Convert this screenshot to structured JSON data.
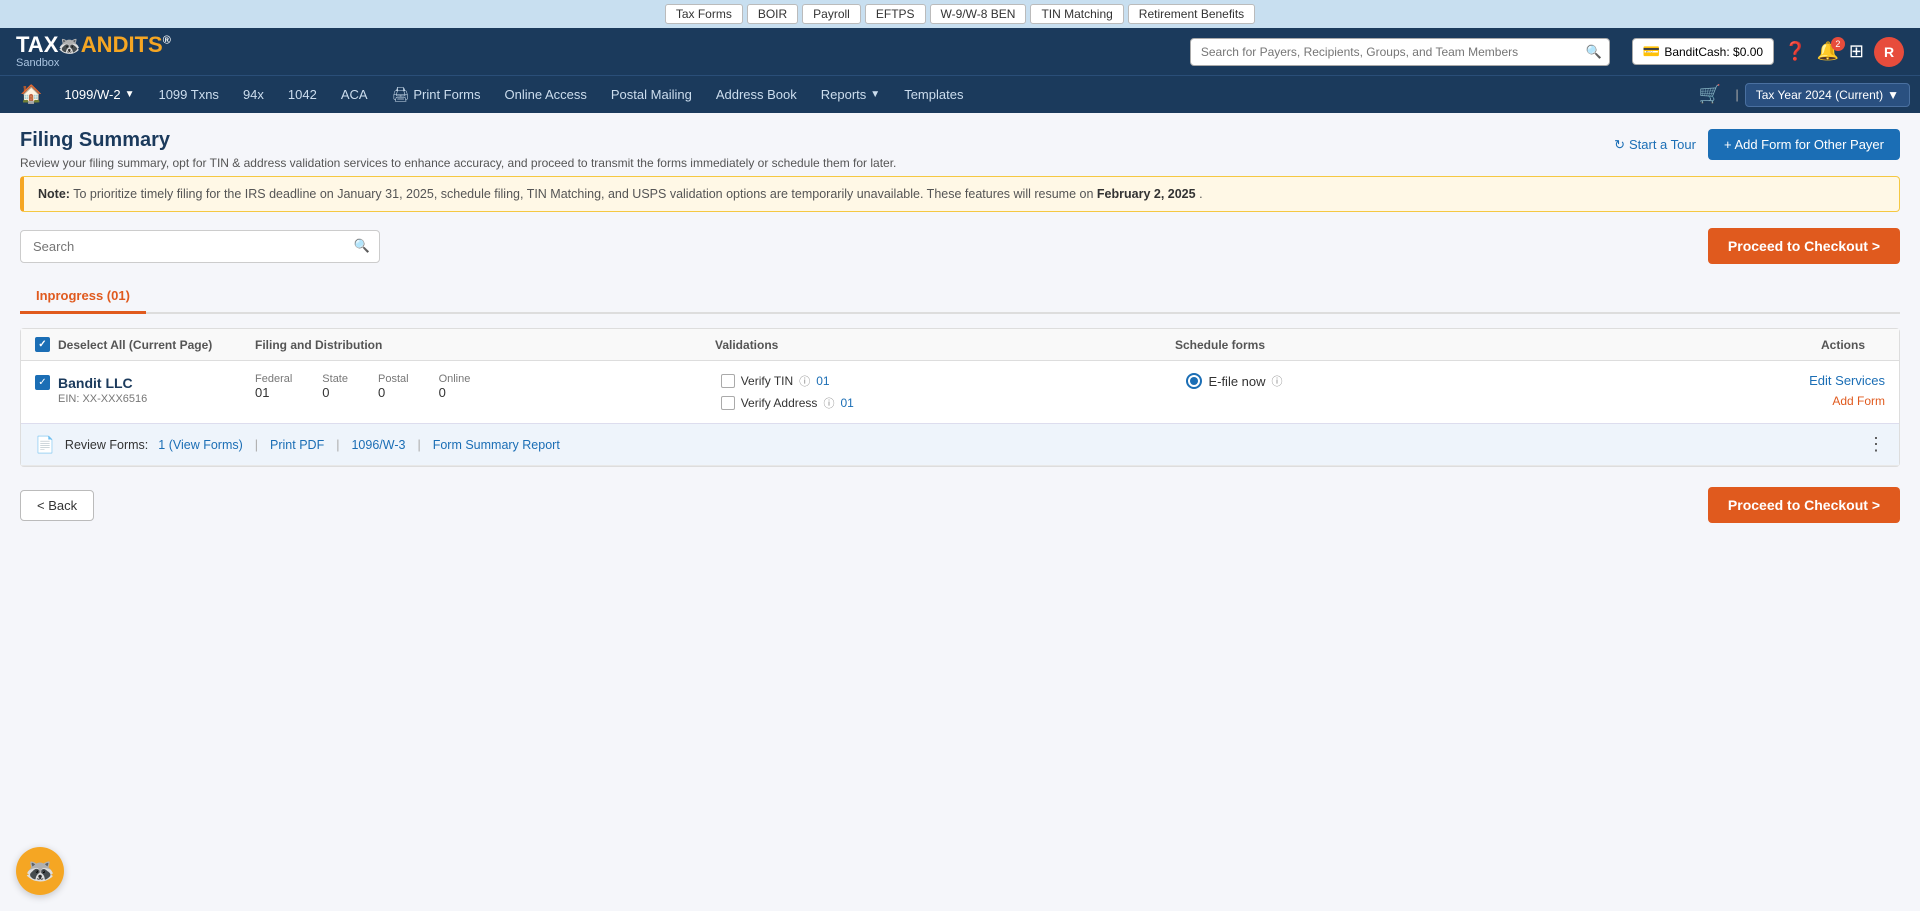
{
  "topnav": {
    "items": [
      {
        "id": "tax-forms",
        "label": "Tax Forms"
      },
      {
        "id": "boir",
        "label": "BOIR"
      },
      {
        "id": "payroll",
        "label": "Payroll"
      },
      {
        "id": "eftps",
        "label": "EFTPS"
      },
      {
        "id": "w9w8ben",
        "label": "W-9/W-8 BEN"
      },
      {
        "id": "tin-matching",
        "label": "TIN Matching"
      },
      {
        "id": "retirement-benefits",
        "label": "Retirement Benefits"
      }
    ]
  },
  "header": {
    "logo_main": "TAX",
    "logo_brand": "BANDITS",
    "logo_reg": "®",
    "sandbox": "Sandbox",
    "search_placeholder": "Search for Payers, Recipients, Groups, and Team Members",
    "bandit_cash_label": "BanditCash: $0.00",
    "notification_count": "2",
    "avatar_initial": "R"
  },
  "mainnav": {
    "items": [
      {
        "id": "1099w2",
        "label": "1099/W-2",
        "has_dropdown": true
      },
      {
        "id": "1099txns",
        "label": "1099 Txns"
      },
      {
        "id": "94x",
        "label": "94x"
      },
      {
        "id": "1042",
        "label": "1042"
      },
      {
        "id": "aca",
        "label": "ACA"
      },
      {
        "id": "print-forms",
        "label": "Print Forms",
        "has_icon": true
      },
      {
        "id": "online-access",
        "label": "Online Access"
      },
      {
        "id": "postal-mailing",
        "label": "Postal Mailing"
      },
      {
        "id": "address-book",
        "label": "Address Book"
      },
      {
        "id": "reports",
        "label": "Reports",
        "has_dropdown": true
      },
      {
        "id": "templates",
        "label": "Templates"
      }
    ],
    "tax_year": "Tax Year 2024 (Current)"
  },
  "page": {
    "title": "Filing Summary",
    "subtitle": "Review your filing summary, opt for TIN & address validation services to enhance accuracy, and proceed to transmit the forms immediately or schedule them for later.",
    "start_tour": "Start a Tour",
    "add_form_btn": "+ Add Form for Other Payer",
    "note": {
      "prefix": "Note:",
      "text": "To prioritize timely filing for the IRS deadline on January 31, 2025, schedule filing, TIN Matching, and USPS validation options are temporarily unavailable. These features will resume on ",
      "date": "February 2, 2025",
      "suffix": "."
    },
    "search_placeholder": "Search",
    "proceed_btn": "Proceed to Checkout >",
    "back_btn": "< Back"
  },
  "tabs": [
    {
      "id": "inprogress",
      "label": "Inprogress (01)",
      "active": true
    }
  ],
  "table": {
    "headers": {
      "deselect": "Deselect All (Current Page)",
      "filing": "Filing and Distribution",
      "validations": "Validations",
      "schedule": "Schedule forms",
      "actions": "Actions"
    },
    "rows": [
      {
        "id": "bandit-llc",
        "name": "Bandit LLC",
        "ein": "EIN: XX-XXX6516",
        "federal": {
          "label": "Federal",
          "value": "01"
        },
        "state": {
          "label": "State",
          "value": "0"
        },
        "postal": {
          "label": "Postal",
          "value": "0"
        },
        "online": {
          "label": "Online",
          "value": "0"
        },
        "verify_tin": "Verify TIN",
        "verify_tin_count": "01",
        "verify_address": "Verify Address",
        "verify_address_count": "01",
        "schedule": "E-file now",
        "edit_services": "Edit Services",
        "add_form": "Add Form",
        "review_prefix": "Review Forms:",
        "review_link": "1 (View Forms)",
        "print_pdf": "Print PDF",
        "form_link": "1096/W-3",
        "summary_link": "Form Summary Report"
      }
    ]
  }
}
